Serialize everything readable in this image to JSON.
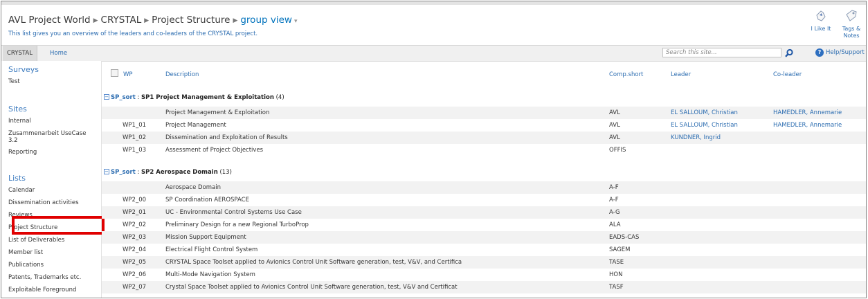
{
  "header": {
    "breadcrumb": [
      "AVL Project World",
      "CRYSTAL",
      "Project Structure"
    ],
    "current_view": "group view",
    "view_arrow": "▾",
    "subtitle": "This list gives you an overview of the leaders and co-leaders of the CRYSTAL project.",
    "social": [
      {
        "label": "I Like It",
        "icon": "thumbs-up-icon"
      },
      {
        "label": "Tags & Notes",
        "icon": "tag-icon"
      }
    ]
  },
  "navbar": {
    "tabs": [
      "CRYSTAL",
      "Home"
    ],
    "search_placeholder": "Search this site...",
    "help_label": "Help/Support"
  },
  "sidebar": {
    "sections": [
      {
        "title": "Surveys",
        "items": [
          "Test"
        ]
      },
      {
        "title": "Sites",
        "items": [
          "Internal",
          "Zusammenarbeit UseCase 3.2",
          "Reporting"
        ]
      },
      {
        "title": "Lists",
        "items": [
          "Calendar",
          "Dissemination activities",
          "Reviews",
          "Project Structure",
          "List of Deliverables",
          "Member list",
          "Publications",
          "Patents, Trademarks etc.",
          "Exploitable Foreground"
        ]
      }
    ],
    "highlighted_item": "Project Structure",
    "highlight_color": "#e00000"
  },
  "table": {
    "columns": {
      "wp": "WP",
      "description": "Description",
      "comp": "Comp.short",
      "leader": "Leader",
      "coleader": "Co-leader"
    },
    "groups": [
      {
        "key": "SP_sort",
        "value": "SP1 Project Management & Exploitation",
        "count": "(4)",
        "rows": [
          {
            "wp": "",
            "desc": "Project Management & Exploitation",
            "comp": "AVL",
            "leader": "EL SALLOUM, Christian",
            "co": "HAMEDLER, Annemarie"
          },
          {
            "wp": "WP1_01",
            "desc": "Project Management",
            "comp": "AVL",
            "leader": "EL SALLOUM, Christian",
            "co": "HAMEDLER, Annemarie"
          },
          {
            "wp": "WP1_02",
            "desc": "Dissemination and Exploitation of Results",
            "comp": "AVL",
            "leader": "KUNDNER, Ingrid",
            "co": ""
          },
          {
            "wp": "WP1_03",
            "desc": "Assessment of Project Objectives",
            "comp": "OFFIS",
            "leader": "",
            "co": ""
          }
        ]
      },
      {
        "key": "SP_sort",
        "value": "SP2 Aerospace Domain",
        "count": "(13)",
        "rows": [
          {
            "wp": "",
            "desc": "Aerospace Domain",
            "comp": "A-F",
            "leader": "",
            "co": ""
          },
          {
            "wp": "WP2_00",
            "desc": "SP Coordination AEROSPACE",
            "comp": "A-F",
            "leader": "",
            "co": ""
          },
          {
            "wp": "WP2_01",
            "desc": "UC - Environmental Control Systems Use Case",
            "comp": "A-G",
            "leader": "",
            "co": ""
          },
          {
            "wp": "WP2_02",
            "desc": "Preliminary Design for a new Regional TurboProp",
            "comp": "ALA",
            "leader": "",
            "co": ""
          },
          {
            "wp": "WP2_03",
            "desc": "Mission Support Equipment",
            "comp": "EADS-CAS",
            "leader": "",
            "co": ""
          },
          {
            "wp": "WP2_04",
            "desc": "Electrical Flight Control System",
            "comp": "SAGEM",
            "leader": "",
            "co": ""
          },
          {
            "wp": "WP2_05",
            "desc": "CRYSTAL Space Toolset applied to Avionics Control Unit Software generation, test, V&V, and Certifica",
            "comp": "TASE",
            "leader": "",
            "co": ""
          },
          {
            "wp": "WP2_06",
            "desc": "Multi-Mode Navigation System",
            "comp": "HON",
            "leader": "",
            "co": ""
          },
          {
            "wp": "WP2_07",
            "desc": "Crystal Space Toolset applied to Avionics Control Unit Software generation, test, V&V and Certificat",
            "comp": "TASF",
            "leader": "",
            "co": ""
          }
        ]
      }
    ]
  }
}
